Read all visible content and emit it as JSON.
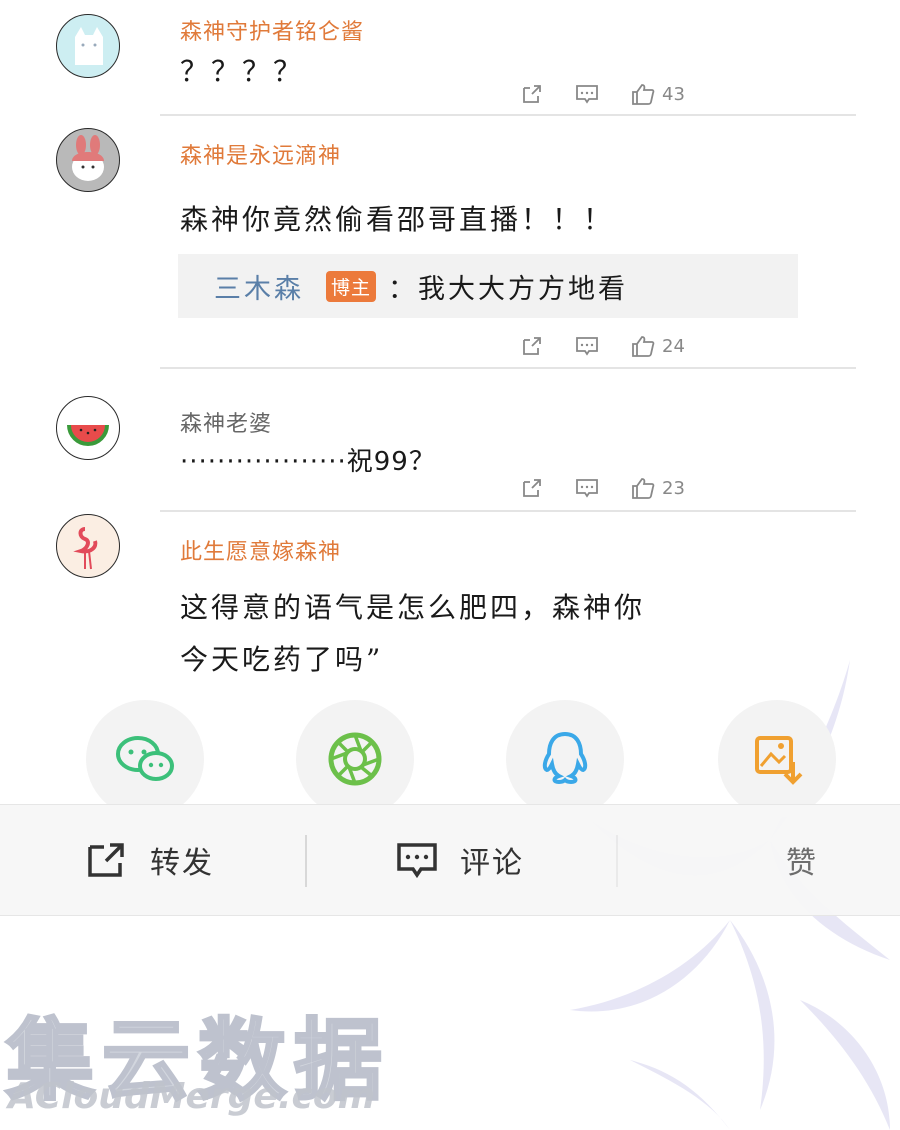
{
  "comments": [
    {
      "username": "森神守护者铭仑酱",
      "text": "？？？？",
      "likes": "43"
    },
    {
      "username": "森神是永远滴神",
      "text": "森神你竟然偷看邵哥直播！！！",
      "reply": {
        "name": "三木森",
        "badge": "博主",
        "text": "：我大大方方地看"
      },
      "likes": "24"
    },
    {
      "username": "森神老婆",
      "text": "··················祝99？",
      "likes": "23"
    },
    {
      "username": "此生愿意嫁森神",
      "text_line1": "这得意的语气是怎么肥四，森神你",
      "text_line2": "今天吃药了吗”"
    }
  ],
  "share_targets": [
    "wechat-icon",
    "moments-icon",
    "qq-icon",
    "save-image-icon"
  ],
  "bottom_bar": {
    "repost": "转发",
    "comment": "评论",
    "like": "赞"
  },
  "watermark": {
    "zh": "集云数据",
    "en": "ACloudMerge.com"
  },
  "colors": {
    "username": "#e07a3a",
    "reply_name": "#5a7fa8",
    "badge": "#ec7a3b"
  }
}
